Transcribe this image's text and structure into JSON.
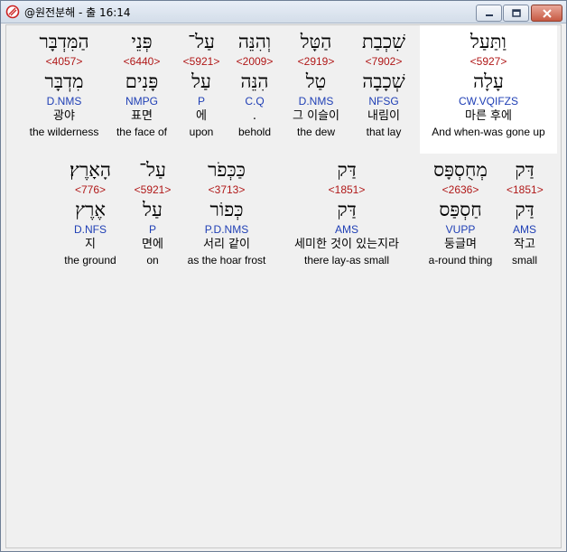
{
  "window": {
    "title": "@원전분해 - 출 16:14"
  },
  "row1": [
    {
      "heb": "וַתַּעַל",
      "strong": "<5927>",
      "lemma": "עָלָה",
      "morph": "CW.VQIFZS",
      "kor": "마른 후에",
      "eng": "And when-was gone up"
    },
    {
      "heb": "שִׁכְבַת",
      "strong": "<7902>",
      "lemma": "שְׁכָבָה",
      "morph": "NFSG",
      "kor": "내림이",
      "eng": "that lay"
    },
    {
      "heb": "הַטָּל",
      "strong": "<2919>",
      "lemma": "טַל",
      "morph": "D.NMS",
      "kor": "그 이슬이",
      "eng": "the dew"
    },
    {
      "heb": "וְהִנֵּה",
      "strong": "<2009>",
      "lemma": "הִנֵּה",
      "morph": "C.Q",
      "kor": ".",
      "eng": "behold"
    },
    {
      "heb": "עַל־",
      "strong": "<5921>",
      "lemma": "עַל",
      "morph": "P",
      "kor": "에",
      "eng": "upon"
    },
    {
      "heb": "פְּנֵי",
      "strong": "<6440>",
      "lemma": "פָּנִים",
      "morph": "NMPG",
      "kor": "표면",
      "eng": "the face of"
    },
    {
      "heb": "הַמִּדְבָּר",
      "strong": "<4057>",
      "lemma": "מִדְבָּר",
      "morph": "D.NMS",
      "kor": "광야",
      "eng": "the wilderness"
    }
  ],
  "row2": [
    {
      "heb": "דַּק",
      "strong": "<1851>",
      "lemma": "דַּק",
      "morph": "AMS",
      "kor": "작고",
      "eng": "small"
    },
    {
      "heb": "מְחֻסְפָּס",
      "strong": "<2636>",
      "lemma": "חַסְפַּס",
      "morph": "VUPP",
      "kor": "둥글며",
      "eng": "a-round thing"
    },
    {
      "heb": "דַּק",
      "strong": "<1851>",
      "lemma": "דַּק",
      "morph": "AMS",
      "kor": "세미한 것이 있는지라",
      "eng": "there lay-as small"
    },
    {
      "heb": "כַּכְּפֹר",
      "strong": "<3713>",
      "lemma": "כְּפוֹר",
      "morph": "P.D.NMS",
      "kor": "서리 같이",
      "eng": "as the hoar frost"
    },
    {
      "heb": "עַל־",
      "strong": "<5921>",
      "lemma": "עַל",
      "morph": "P",
      "kor": "면에",
      "eng": "on"
    },
    {
      "heb": "הָאָרֶץ׃",
      "strong": "<776>",
      "lemma": "אֶרֶץ",
      "morph": "D.NFS",
      "kor": "지",
      "eng": "the ground"
    }
  ]
}
